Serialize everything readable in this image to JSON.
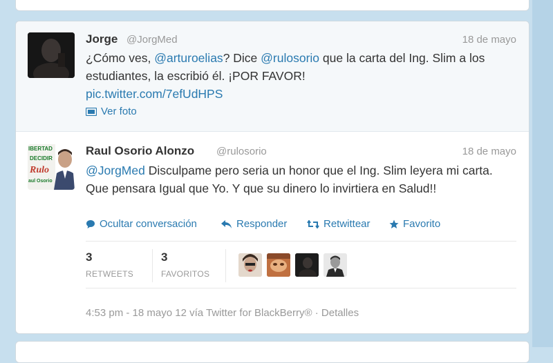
{
  "tweet1": {
    "name": "Jorge",
    "handle": "@JorgMed",
    "date": "18 de mayo",
    "text_parts": {
      "a": "¿Cómo ves, ",
      "mention1": "@arturoelias",
      "b": "? Dice ",
      "mention2": "@rulosorio",
      "c": " que la carta del Ing. Slim a los estudiantes, la escribió él. ¡POR FAVOR!"
    },
    "pic_link": "pic.twitter.com/7efUdHPS",
    "view_photo": "Ver foto"
  },
  "tweet2": {
    "name": "Raul Osorio Alonzo",
    "handle": "@rulosorio",
    "date": "18 de mayo",
    "mention": "@JorgMed",
    "text": " Disculpame pero seria un honor que el Ing. Slim leyera mi carta. Que pensara Igual que Yo. Y que su dinero lo invirtiera en Salud!!",
    "avatar_text": {
      "line1": "IBERTAD",
      "line2": "DECIDIR",
      "line3": "Rulo",
      "line4": "aul Osorio"
    },
    "actions": {
      "hide": "Ocultar conversación",
      "reply": "Responder",
      "retweet": "Retwittear",
      "favorite": "Favorito"
    },
    "stats": {
      "retweets_count": "3",
      "retweets_label": "RETWEETS",
      "favorites_count": "3",
      "favorites_label": "FAVORITOS"
    },
    "footer": "4:53 pm - 18 mayo 12 vía Twitter for BlackBerry® · Detalles"
  },
  "colors": {
    "link": "#2a7ab0",
    "background": "#c7dfee"
  }
}
